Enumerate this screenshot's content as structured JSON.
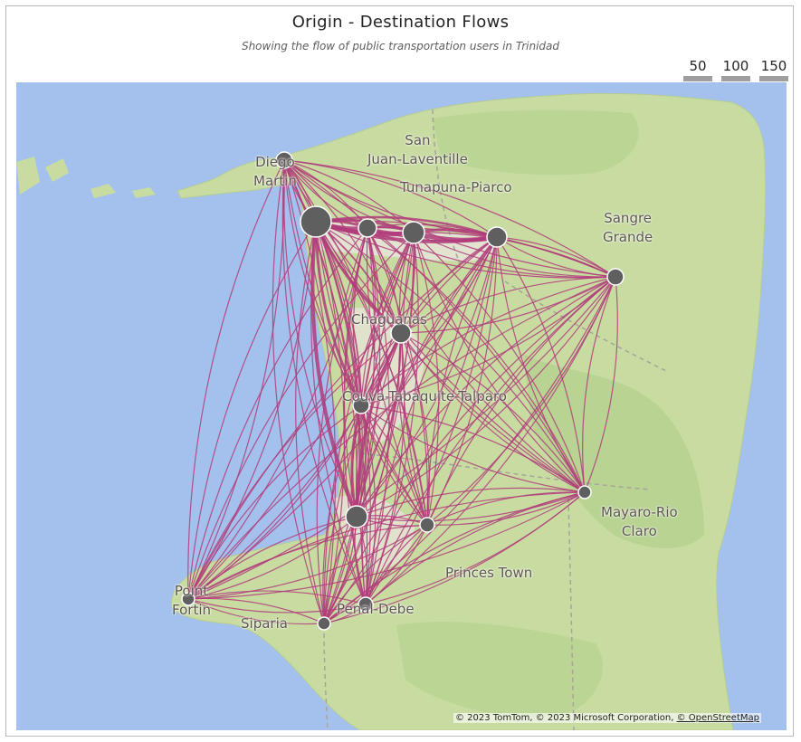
{
  "header": {
    "title": "Origin - Destination Flows",
    "subtitle": "Showing the flow of public transportation users in Trinidad"
  },
  "legend": {
    "items": [
      {
        "label": "50"
      },
      {
        "label": "100"
      },
      {
        "label": "150"
      }
    ]
  },
  "map": {
    "places": [
      {
        "text": "San\nJuan-Laventille"
      },
      {
        "text": "Tunapuna-Piarco"
      },
      {
        "text": "Sangre\nGrande"
      },
      {
        "text": "Diego\nMartin"
      },
      {
        "text": "Chaguanas"
      },
      {
        "text": "Couva-Tabaquite-Talparo"
      },
      {
        "text": "Mayaro-Rio\nClaro"
      },
      {
        "text": "Princes Town"
      },
      {
        "text": "Point\nFortin"
      },
      {
        "text": "Siparia"
      },
      {
        "text": "Penal-Debe"
      }
    ],
    "attribution": {
      "text": "© 2023 TomTom, © 2023 Microsoft Corporation, ",
      "link": "© OpenStreetMap"
    },
    "colors": {
      "water": "#a3c1ec",
      "land": "#c8dca2",
      "flow": "#b03c7a",
      "node": "#5f5f5f"
    }
  }
}
